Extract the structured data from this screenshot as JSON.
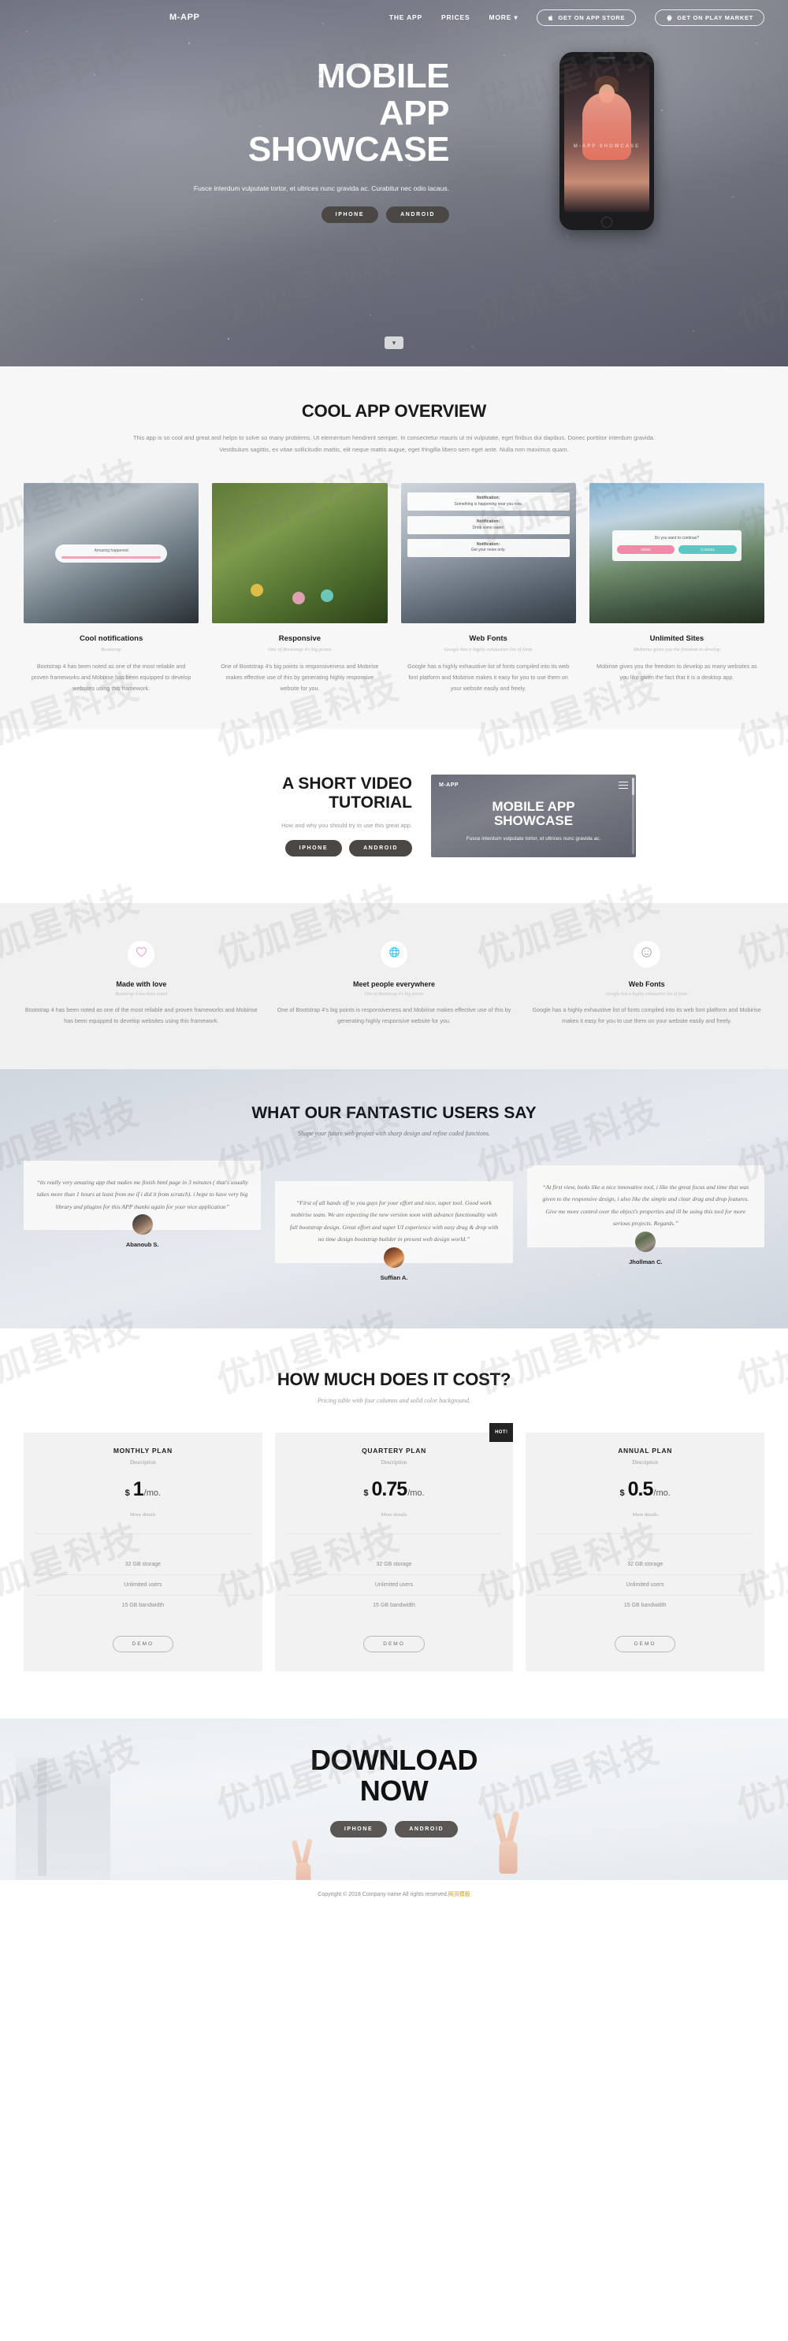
{
  "nav": {
    "brand": "M-APP",
    "links": [
      {
        "label": "THE APP"
      },
      {
        "label": "PRICES"
      },
      {
        "label": "MORE ▾"
      }
    ],
    "buttons": [
      {
        "label": "GET ON APP STORE",
        "icon": "apple-icon"
      },
      {
        "label": "GET ON PLAY MARKET",
        "icon": "android-robot-icon"
      }
    ]
  },
  "hero": {
    "title_lines": [
      "MOBILE",
      "APP",
      "SHOWCASE"
    ],
    "subtitle": "Fusce interdum vulputate tortor, et ultrices nunc gravida ac. Curabitur nec odio lacaus.",
    "buttons": [
      {
        "label": "IPHONE"
      },
      {
        "label": "ANDROID"
      }
    ],
    "phone_label": "M-APP SHOWCASE",
    "scroll_icon": "chevron-down-icon"
  },
  "overview": {
    "title": "COOL APP OVERVIEW",
    "lead": "This app is so cool and great and helps to solve so many problems. Ut elementum hendrerit semper. In consectetur mauris ut mi vulputate, eget finibus dui dapibus. Donec porttitor interdum gravida. Vestibulum sagittis, ex vitae sollicitudin mattis, elit neque mattis augue, eget fringilla libero sem eget ante. Nulla non maximus quam.",
    "cards": [
      {
        "title": "Cool notifications",
        "kicker": "Bootstrap",
        "text": "Bootstrap 4 has been noted as one of the most reliable and proven frameworks and Mobirise has been equipped to develop websites using this framework.",
        "overlay_label": "Amazing happened"
      },
      {
        "title": "Responsive",
        "kicker": "One of Bootstrap 4's big points",
        "text": "One of Bootstrap 4's big points is responsiveness and Mobirise makes effective use of this by generating highly responsive website for you."
      },
      {
        "title": "Web Fonts",
        "kicker": "Google has a highly exhaustive list of fonts",
        "text": "Google has a highly exhaustive list of fonts compiled into its web font platform and Mobirise makes it easy for you to use them on your website easily and freely.",
        "notifications": [
          {
            "title": "Notification:",
            "body": "Something is happening near you now."
          },
          {
            "title": "Notification:",
            "body": "Drink some water!"
          },
          {
            "title": "Notification:",
            "body": "Get your news only."
          }
        ]
      },
      {
        "title": "Unlimited Sites",
        "kicker": "Mobirise gives you the freedom to develop",
        "text": "Mobirise gives you the freedom to develop as many websites as you like given the fact that it is a desktop app.",
        "modal": {
          "question": "Do you want to continue?",
          "yes": "SEND",
          "no": "CANCEL"
        }
      }
    ]
  },
  "video": {
    "title_lines": [
      "A SHORT VIDEO",
      "TUTORIAL"
    ],
    "subtitle": "How and why you should try to use this great app.",
    "buttons": [
      {
        "label": "IPHONE"
      },
      {
        "label": "ANDROID"
      }
    ],
    "preview": {
      "brand": "M-APP",
      "menu_icon": "hamburger-menu-icon",
      "title_lines": [
        "MOBILE APP",
        "SHOWCASE"
      ],
      "caption": "Fusce interdum vulputate tortor, et ultrices nunc gravida ac."
    }
  },
  "icon_features": [
    {
      "icon": "heart-icon",
      "color": "#e79ec6",
      "title": "Made with love",
      "kicker": "Bootstrap 4 has been noted",
      "text": "Bootstrap 4 has been noted as one of the most reliable and proven frameworks and Mobirise has been equipped to develop websites using this framework."
    },
    {
      "icon": "globe-icon",
      "color": "#24bdf0",
      "title": "Meet people everywhere",
      "kicker": "One of Bootstrap 4's big points",
      "text": "One of Bootstrap 4's big points is responsiveness and Mobirise makes effective use of this by generating highly responsive website for you."
    },
    {
      "icon": "smiley-face-icon",
      "color": "#9a9a9a",
      "title": "Web Fonts",
      "kicker": "Google has a highly exhaustive list of fonts",
      "text": "Google has a highly exhaustive list of fonts compiled into its web font platform and Mobirise makes it easy for you to use them on your website easily and freely."
    }
  ],
  "testimonials": {
    "title": "WHAT OUR FANTASTIC USERS SAY",
    "subtitle": "Shape your future web project with sharp design and refine coded functions.",
    "items": [
      {
        "quote": "“its really very amazing app that makes me finish html page in 3 minutes ( that's usually takes more than 1 hours at least from me if i did it from scratch). i hope to have very big library and plugins for this APP thanks again for your nice application”",
        "name": "Abanoub S."
      },
      {
        "quote": "“First of all hands off to you guys for your effort and nice, super tool. Good work mobirise team. We are expecting the new version soon with advance functionality with full bootstrap design. Great effort and super UI experience with easy drag & drop with no time design bootstrap builder in present web design world.”",
        "name": "Suffian A."
      },
      {
        "quote": "“At first view, looks like a nice innovative tool, i like the great focus and time that was given to the responsive design, i also like the simple and clear drag and drop features. Give me more control over the object's properties and ill be using this tool for more serious projects. Regards.”",
        "name": "Jhollman C."
      }
    ]
  },
  "pricing": {
    "title": "HOW MUCH DOES IT COST?",
    "subtitle": "Pricing table with four columns and solid color background.",
    "badge": "HOT!",
    "plans": [
      {
        "name": "MONTHLY PLAN",
        "description": "Description",
        "currency": "$",
        "amount": "1",
        "period": "/mo.",
        "more": "More details",
        "features": [
          "32 GB storage",
          "Unlimited users",
          "15 GB bandwidth"
        ],
        "button": "DEMO",
        "hot": false
      },
      {
        "name": "QUARTERY PLAN",
        "description": "Description",
        "currency": "$",
        "amount": "0.75",
        "period": "/mo.",
        "more": "More details",
        "features": [
          "32 GB storage",
          "Unlimited users",
          "15 GB bandwidth"
        ],
        "button": "DEMO",
        "hot": true
      },
      {
        "name": "ANNUAL PLAN",
        "description": "Description",
        "currency": "$",
        "amount": "0.5",
        "period": "/mo.",
        "more": "More details",
        "features": [
          "32 GB storage",
          "Unlimited users",
          "15 GB bandwidth"
        ],
        "button": "DEMO",
        "hot": false
      }
    ]
  },
  "download": {
    "title_lines": [
      "DOWNLOAD",
      "NOW"
    ],
    "buttons": [
      {
        "label": "IPHONE"
      },
      {
        "label": "ANDROID"
      }
    ]
  },
  "footer": {
    "copyright": "Copyright © 2018 Company name All rights reserved.",
    "link": "网页模板"
  },
  "watermark": "优加星科技"
}
